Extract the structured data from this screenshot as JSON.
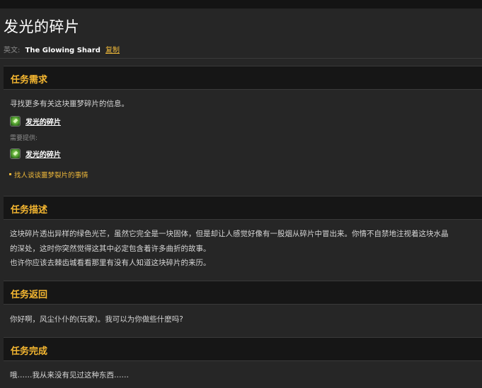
{
  "page": {
    "title": "发光的碎片",
    "english_label": "英文:",
    "english_name": "The Glowing Shard",
    "copy_label": "复制"
  },
  "requirements": {
    "header": "任务需求",
    "intro": "寻找更多有关这块噩梦碎片的信息。",
    "item_name": "发光的碎片",
    "provided_label": "需要提供:",
    "provided_item_name": "发光的碎片",
    "objective": "找人谈谈噩梦裂片的事情"
  },
  "description": {
    "header": "任务描述",
    "line1": "这块碎片透出异样的绿色光芒，虽然它完全是一块固体，但是却让人感觉好像有一股烟从碎片中冒出来。你情不自禁地注视着这块水晶",
    "line2": "的深处，这时你突然觉得这其中必定包含着许多曲折的故事。",
    "line3": "也许你应该去棘齿城看看那里有没有人知道这块碎片的来历。"
  },
  "progress": {
    "header": "任务返回",
    "text": "你好啊，风尘仆仆的(玩家)。我可以为你做些什麽吗?"
  },
  "completion": {
    "header": "任务完成",
    "text": "哦……我从来没有见过这种东西……"
  },
  "colors": {
    "accent": "#f5b731",
    "background": "#262626",
    "header_bg": "#161616"
  },
  "icons": {
    "item": "glowing-shard-icon"
  }
}
